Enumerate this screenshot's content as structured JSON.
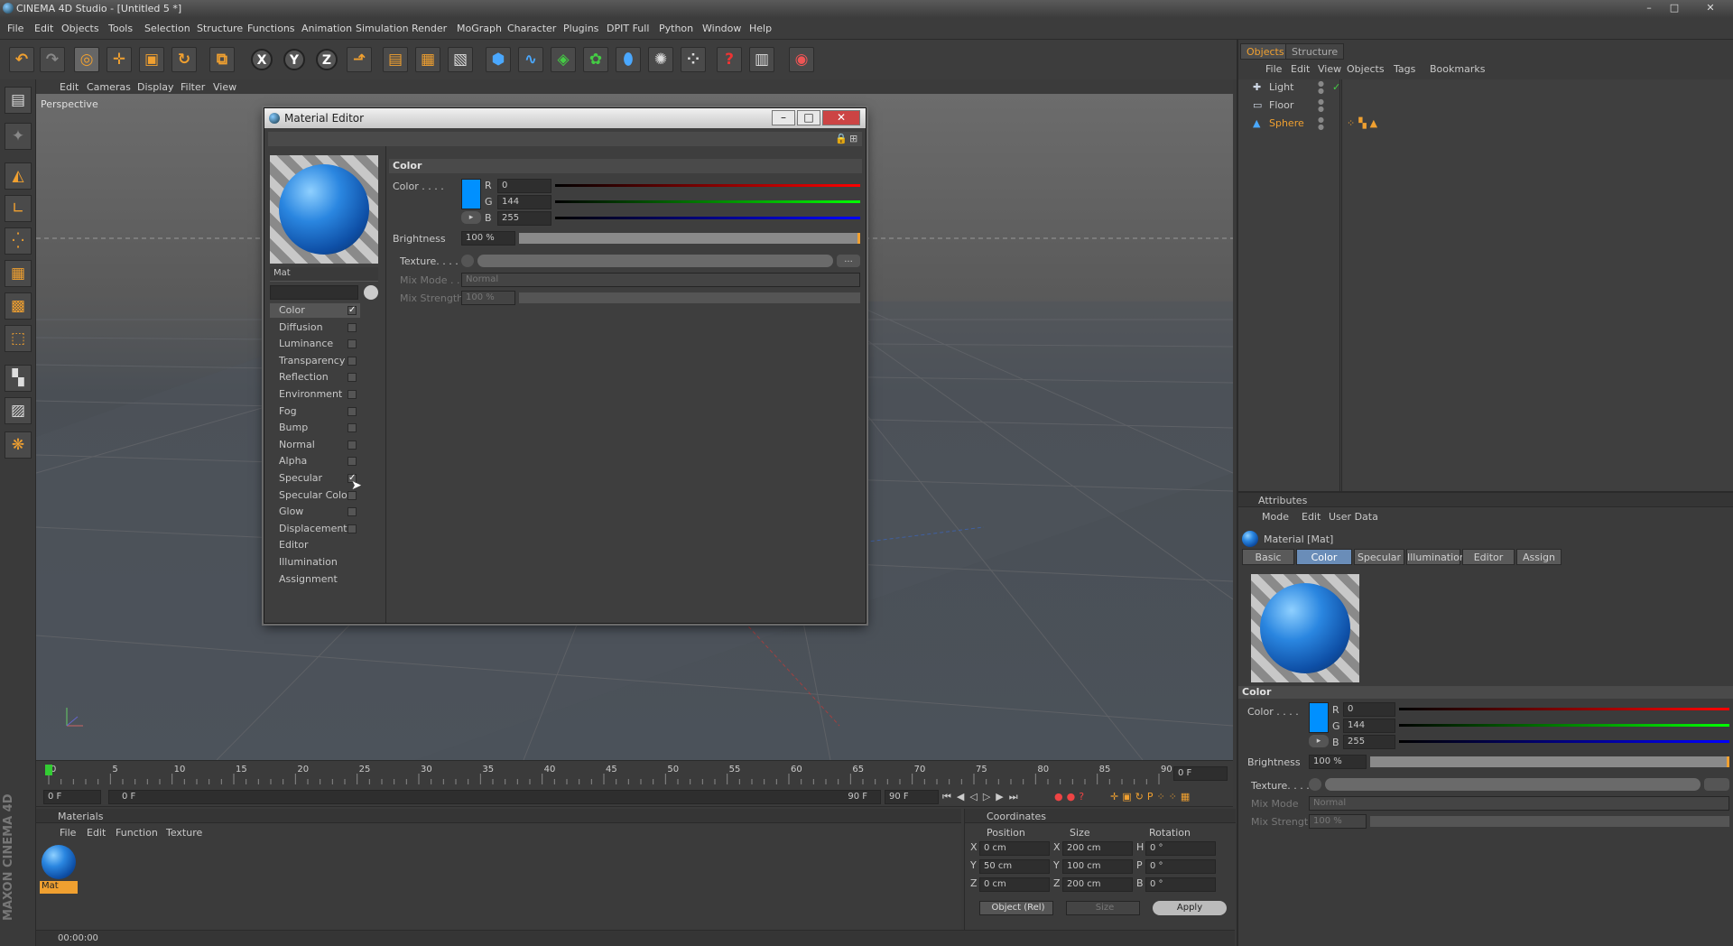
{
  "window": {
    "title": "CINEMA 4D Studio - [Untitled 5 *]",
    "min": "–",
    "max": "□",
    "close": "✕"
  },
  "menu": [
    "File",
    "Edit",
    "Objects",
    "Tools",
    "Selection",
    "Structure",
    "Functions",
    "Animation",
    "Simulation",
    "Render",
    "MoGraph",
    "Character",
    "Plugins",
    "DPIT Full",
    "Python",
    "Window",
    "Help"
  ],
  "toolbar": {
    "icons": [
      "undo-icon",
      "redo-icon",
      "live-select-icon",
      "move-icon",
      "scale-icon",
      "rotate-icon",
      "coordinate-system-icon",
      "x-axis-icon",
      "y-axis-icon",
      "z-axis-icon",
      "world-icon",
      "render-view-icon",
      "render-picture-viewer-icon",
      "render-settings-icon",
      "cube-icon",
      "spline-icon",
      "nurbs-icon",
      "array-icon",
      "deformer-icon",
      "scene-icon",
      "particles-icon",
      "help-icon",
      "timeline-icon",
      "sphere-icon"
    ],
    "x": "X",
    "y": "Y",
    "z": "Z"
  },
  "viewport": {
    "menu": [
      "Edit",
      "Cameras",
      "Display",
      "Filter",
      "View"
    ],
    "label": "Perspective"
  },
  "timeline": {
    "ticks": [
      "0",
      "5",
      "10",
      "15",
      "20",
      "25",
      "30",
      "35",
      "40",
      "45",
      "50",
      "55",
      "60",
      "65",
      "70",
      "75",
      "80",
      "85",
      "90"
    ],
    "current_frame": "0 F",
    "start": "0 F",
    "range_start": "0 F",
    "range_end": "90 F",
    "end": "90 F"
  },
  "materials": {
    "title": "Materials",
    "menu": [
      "File",
      "Edit",
      "Function",
      "Texture"
    ],
    "items": [
      {
        "name": "Mat"
      }
    ]
  },
  "coordinates": {
    "title": "Coordinates",
    "headers": [
      "Position",
      "Size",
      "Rotation"
    ],
    "rows": [
      {
        "axis": "X",
        "pos": "0 cm",
        "size_axis": "X",
        "size": "200 cm",
        "rot_axis": "H",
        "rot": "0 °"
      },
      {
        "axis": "Y",
        "pos": "50 cm",
        "size_axis": "Y",
        "size": "100 cm",
        "rot_axis": "P",
        "rot": "0 °"
      },
      {
        "axis": "Z",
        "pos": "0 cm",
        "size_axis": "Z",
        "size": "200 cm",
        "rot_axis": "B",
        "rot": "0 °"
      }
    ],
    "mode": "Object (Rel)",
    "size_mode": "Size",
    "apply": "Apply"
  },
  "status": {
    "time": "00:00:00"
  },
  "objects_panel": {
    "tabs": [
      "Objects",
      "Structure"
    ],
    "menu": [
      "File",
      "Edit",
      "View",
      "Objects",
      "Tags",
      "Bookmarks"
    ],
    "items": [
      {
        "name": "Light",
        "selected": false
      },
      {
        "name": "Floor",
        "selected": false
      },
      {
        "name": "Sphere",
        "selected": true
      }
    ]
  },
  "attributes": {
    "title": "Attributes",
    "menu": [
      "Mode",
      "Edit",
      "User Data"
    ],
    "object": "Material [Mat]",
    "tabs": [
      "Basic",
      "Color",
      "Specular",
      "Illumination",
      "Editor",
      "Assign"
    ],
    "active_tab": "Color",
    "section": "Color",
    "color_label": "Color . . . .",
    "r_label": "R",
    "g_label": "G",
    "b_label": "B",
    "r": "0",
    "g": "144",
    "b": "255",
    "brightness_label": "Brightness",
    "brightness": "100 %",
    "texture_label": "Texture. . . . .",
    "mixmode_label": "Mix Mode",
    "mixmode": "Normal",
    "mixstrength_label": "Mix Strength",
    "mixstrength": "100 %"
  },
  "material_editor": {
    "title": "Material Editor",
    "material_name": "Mat",
    "channels": [
      {
        "name": "Color",
        "checked": true,
        "active": true
      },
      {
        "name": "Diffusion",
        "checked": false
      },
      {
        "name": "Luminance",
        "checked": false
      },
      {
        "name": "Transparency",
        "checked": false
      },
      {
        "name": "Reflection",
        "checked": false
      },
      {
        "name": "Environment",
        "checked": false
      },
      {
        "name": "Fog",
        "checked": false
      },
      {
        "name": "Bump",
        "checked": false
      },
      {
        "name": "Normal",
        "checked": false
      },
      {
        "name": "Alpha",
        "checked": false
      },
      {
        "name": "Specular",
        "checked": true
      },
      {
        "name": "Specular Color",
        "checked": false
      },
      {
        "name": "Glow",
        "checked": false
      },
      {
        "name": "Displacement",
        "checked": false
      },
      {
        "name": "Editor",
        "checked": null
      },
      {
        "name": "Illumination",
        "checked": null
      },
      {
        "name": "Assignment",
        "checked": null
      }
    ],
    "section": "Color",
    "color_label": "Color . . . .",
    "r_label": "R",
    "g_label": "G",
    "b_label": "B",
    "r": "0",
    "g": "144",
    "b": "255",
    "brightness_label": "Brightness",
    "brightness": "100 %",
    "texture_label": "Texture. . . . .",
    "texture_btn": "...",
    "mixmode_label": "Mix Mode . .",
    "mixmode": "Normal",
    "mixstrength_label": "Mix Strength",
    "mixstrength": "100 %"
  },
  "colors": {
    "swatch": "#0090ff",
    "accent": "#f0a030"
  }
}
